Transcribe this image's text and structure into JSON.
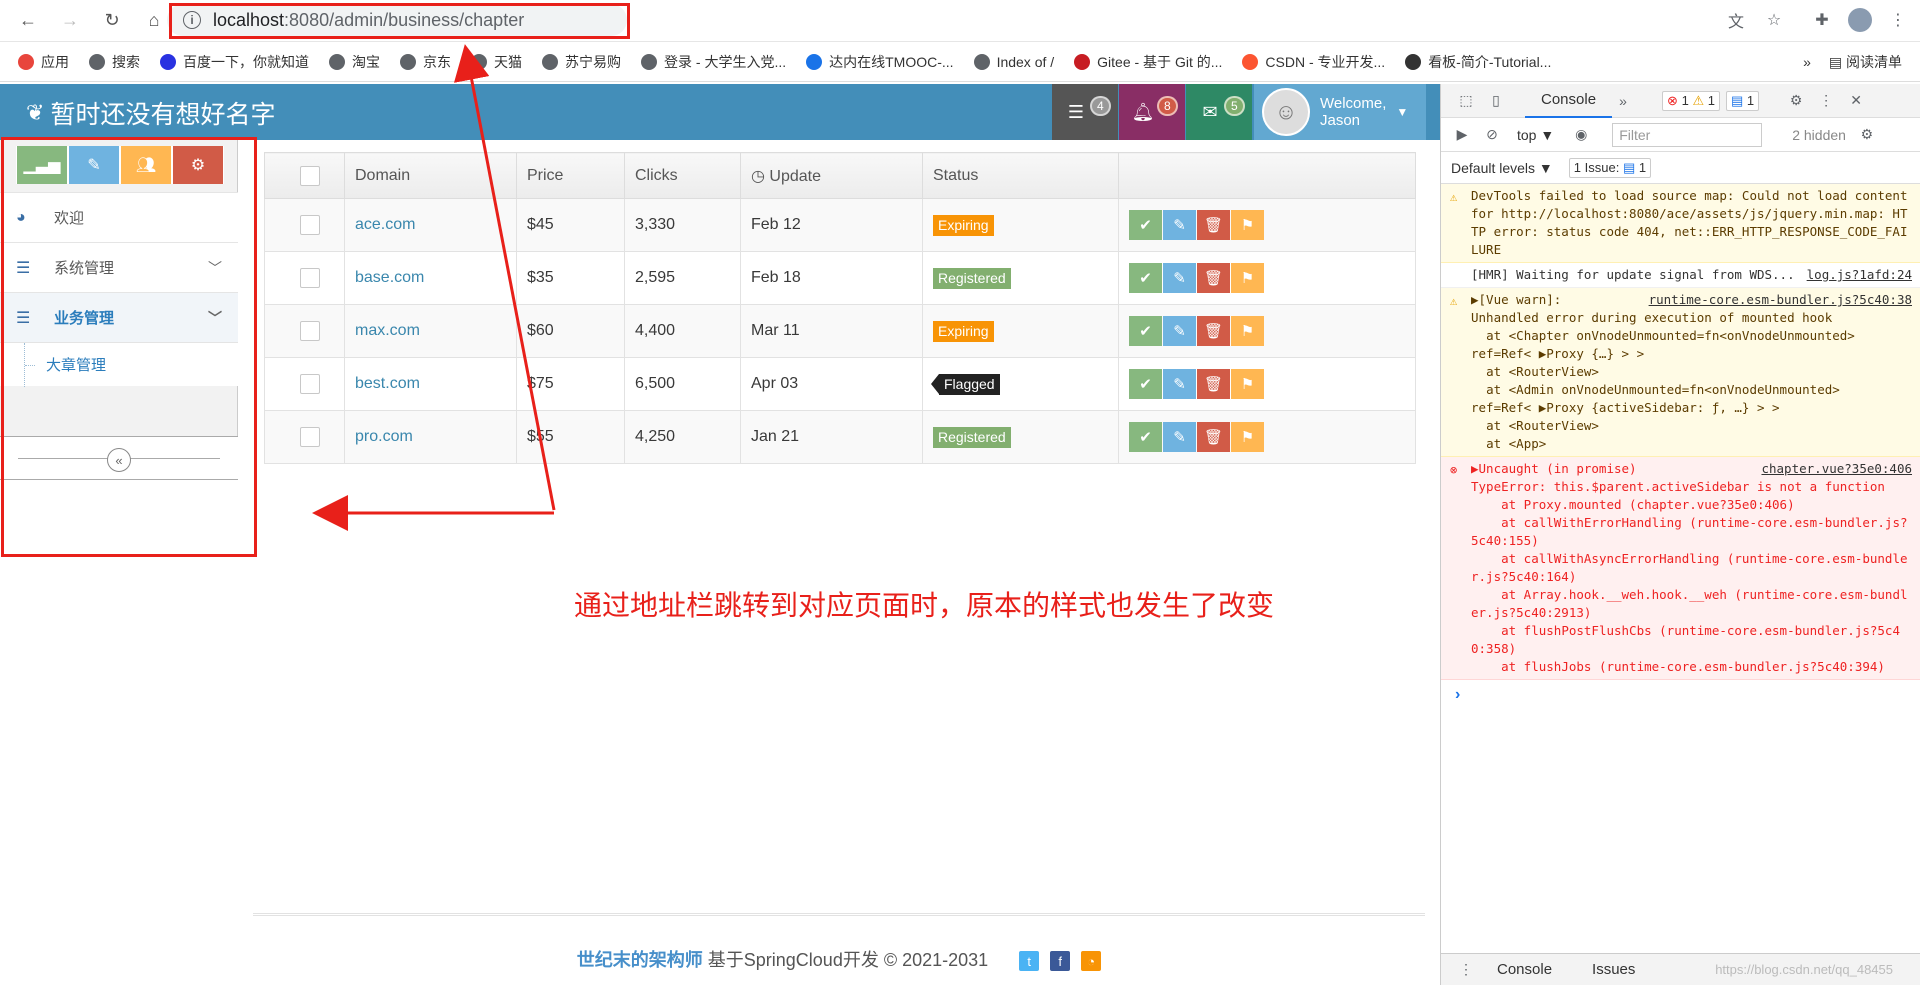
{
  "browser": {
    "url_host": "localhost",
    "url_path": ":8080/admin/business/chapter",
    "bookmarks": [
      {
        "label": "应用",
        "color": "#e8453c"
      },
      {
        "label": "搜索",
        "color": "#5f6368"
      },
      {
        "label": "百度一下，你就知道",
        "color": "#2932e1"
      },
      {
        "label": "淘宝",
        "color": "#5f6368"
      },
      {
        "label": "京东",
        "color": "#5f6368"
      },
      {
        "label": "天猫",
        "color": "#5f6368"
      },
      {
        "label": "苏宁易购",
        "color": "#5f6368"
      },
      {
        "label": "登录 - 大学生入党...",
        "color": "#5f6368"
      },
      {
        "label": "达内在线TMOOC-...",
        "color": "#1a73e8"
      },
      {
        "label": "Index of /",
        "color": "#5f6368"
      },
      {
        "label": "Gitee - 基于 Git 的...",
        "color": "#c71d23"
      },
      {
        "label": "CSDN - 专业开发...",
        "color": "#fc5531"
      },
      {
        "label": "看板-简介-Tutorial...",
        "color": "#333333"
      }
    ],
    "more": "»",
    "reading_list": "阅读清单"
  },
  "app": {
    "brand": "暂时还没有想好名字",
    "nav": {
      "tasks_count": "4",
      "notifications_count": "8",
      "messages_count": "5",
      "welcome": "Welcome,",
      "user": "Jason"
    },
    "sidebar": {
      "items": [
        {
          "label": "欢迎"
        },
        {
          "label": "系统管理"
        },
        {
          "label": "业务管理"
        }
      ],
      "sub_item": "大章管理",
      "collapse": "«"
    },
    "table": {
      "headers": [
        "Domain",
        "Price",
        "Clicks",
        "Update",
        "Status"
      ],
      "rows": [
        {
          "domain": "ace.com",
          "price": "$45",
          "clicks": "3,330",
          "update": "Feb 12",
          "status": "Expiring"
        },
        {
          "domain": "base.com",
          "price": "$35",
          "clicks": "2,595",
          "update": "Feb 18",
          "status": "Registered"
        },
        {
          "domain": "max.com",
          "price": "$60",
          "clicks": "4,400",
          "update": "Mar 11",
          "status": "Expiring"
        },
        {
          "domain": "best.com",
          "price": "$75",
          "clicks": "6,500",
          "update": "Apr 03",
          "status": "Flagged"
        },
        {
          "domain": "pro.com",
          "price": "$55",
          "clicks": "4,250",
          "update": "Jan 21",
          "status": "Registered"
        }
      ]
    },
    "annotation": "通过地址栏跳转到对应页面时，原本的样式也发生了改变",
    "footer": {
      "brand": "世纪末的架构师",
      "text": " 基于SpringCloud开发 © 2021-2031"
    }
  },
  "devtools": {
    "tab": "Console",
    "error_count": "1",
    "warn_count": "1",
    "info_count": "1",
    "context": "top",
    "filter_placeholder": "Filter",
    "hidden": "2 hidden",
    "levels": "Default levels",
    "issues": "1 Issue:",
    "issues_count": "1",
    "messages": [
      {
        "level": "warn",
        "src": "",
        "text": "DevTools failed to load source map: Could not load content for http://localhost:8080/ace/assets/js/jquery.min.map: HTTP error: status code 404, net::ERR_HTTP_RESPONSE_CODE_FAILURE"
      },
      {
        "level": "log",
        "src": "log.js?1afd:24",
        "text": "[HMR] Waiting for update signal from WDS..."
      },
      {
        "level": "warn",
        "src": "runtime-core.esm-bundler.js?5c40:38",
        "text": "▶[Vue warn]: \nUnhandled error during execution of mounted hook\n  at <Chapter onVnodeUnmounted=fn<onVnodeUnmounted>\nref=Ref< ▶Proxy {…} > >\n  at <RouterView>\n  at <Admin onVnodeUnmounted=fn<onVnodeUnmounted>\nref=Ref< ▶Proxy {activeSidebar: ƒ, …} > >\n  at <RouterView>\n  at <App>"
      },
      {
        "level": "err",
        "src": "chapter.vue?35e0:406",
        "text": "▶Uncaught (in promise) \nTypeError: this.$parent.activeSidebar is not a function\n    at Proxy.mounted (chapter.vue?35e0:406)\n    at callWithErrorHandling (runtime-core.esm-bundler.js?5c40:155)\n    at callWithAsyncErrorHandling (runtime-core.esm-bundler.js?5c40:164)\n    at Array.hook.__weh.hook.__weh (runtime-core.esm-bundler.js?5c40:2913)\n    at flushPostFlushCbs (runtime-core.esm-bundler.js?5c40:358)\n    at flushJobs (runtime-core.esm-bundler.js?5c40:394)"
      }
    ],
    "prompt": "›",
    "bottom_tabs": [
      "Console",
      "Issues"
    ],
    "watermark": "https://blog.csdn.net/qq_48455"
  }
}
